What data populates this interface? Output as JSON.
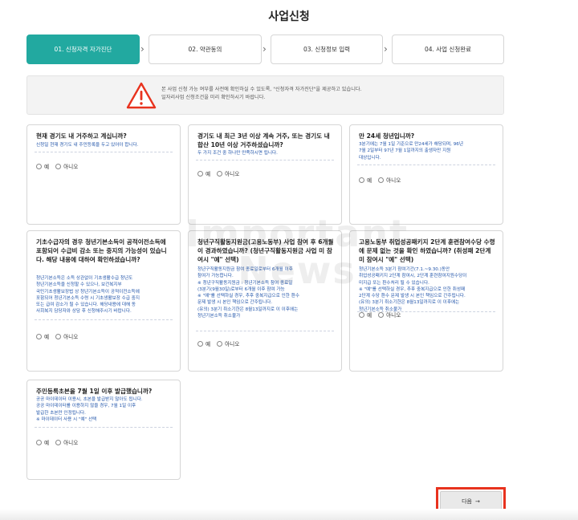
{
  "page": {
    "title": "사업신청"
  },
  "steps": [
    {
      "label": "01. 신청자격 자가진단",
      "active": true
    },
    {
      "label": "02. 약관동의",
      "active": false
    },
    {
      "label": "03. 신청정보 입력",
      "active": false
    },
    {
      "label": "04. 사업 신청완료",
      "active": false
    }
  ],
  "step_arrow": "›",
  "notice": {
    "line1": "본 사업 신청 가능 여부를 사전에 확인하실 수 있도록, \"신청자격 자가진단\"을 제공하고 있습니다.",
    "line2": "일자리사업 신청조건을 미리 확인하시기 바랍니다.",
    "icon": "warning-triangle-icon",
    "icon_color": "#e8321e"
  },
  "radio": {
    "yes": "예",
    "no": "아니오"
  },
  "questions": [
    {
      "title": "현재 경기도 내 거주하고 계십니까?",
      "desc": [
        "신청일 현재 경기도 내 주민등록을 두고 있어야 합니다."
      ]
    },
    {
      "title": "경기도 내 최근 3년 이상 계속 거주, 또는 경기도 내 합산 10년 이상 거주하셨습니까?",
      "desc": [
        "두 가지 조건 중 하나만 만족하시면 됩니다."
      ]
    },
    {
      "title": "만 24세 청년입니까?",
      "desc": [
        "3분기에는 7월 1일 기준으로 만24세가 해당되며, 96년",
        "7월 2일부터 97년 7월 1일까지의 출생자만 지원",
        "대상입니다."
      ]
    },
    {
      "title": "기초수급자의 경우 청년기본소득이 공적이전소득에 포함되어 수급비 감소 또는 중지의 가능성이 있습니다. 해당 내용에 대하여 확인하셨습니까?",
      "desc": [
        "청년기본소득은 소득 상관없이 기초생활수급 청년도",
        "청년기본소득을 신청할 수 있으나, 보건복지부",
        "국민기초생활보장법 상 청년기본소득이 공적이전소득에",
        "포함되어 청년기본소득 수령 시 기초생활보장 수급 중지",
        "또는 급여 감소가 될 수 있습니다. 해당내용에 대해 동",
        "사회복지 담당자와 상담 후 신청해주시기 바랍니다."
      ]
    },
    {
      "title": "청년구직활동지원금(고용노동부) 사업 참여 후 6개월이 경과하였습니까? (청년구직활동지원금 사업 미 참여시 \"예\" 선택)",
      "desc": [
        "청년구직활동지원금 참여 종료일로부터 6개월 이후",
        "참여가 가능합니다.",
        "※ 청년구직활동지원금 : 청년기본소득 참여 종료일",
        "(3분기(9월30일)로부터 6개월 이후 참여 가능",
        "※ \"예\"를 선택하실 경우, 추후 중복지급으로 인한 환수",
        "문제 발생 시 본인 책임으로 간주됩니다.",
        "(유의) 3분기 취소기한은 8월13일까지로 이 이후에는",
        "청년기본소득 취소불가"
      ]
    },
    {
      "title": "고용노동부 취업성공패키지 2단계 훈련참여수당 수령에 문제 없는 것을 확인 하였습니까? (취성패 2단계 미 참여시 \"예\" 선택)",
      "desc": [
        "청년기본소득 3분기 참여기간(7.1.~9.30.)동안",
        "취업성공패키지 2단계 참여시, 2단계 훈련참여지원수당이",
        "미지급 또는 환수처리 될 수 있습니다.",
        "※ \"예\"를 선택하실 경우, 추후 중복지급으로 인한 취성패",
        "2단계 수당 환수 문제 발생 시 본인 책임으로 간주됩니다.",
        "(유의) 3분기 취소기한은 8월13일까지로 이 이후에는",
        "청년기본소득 취소불가"
      ]
    },
    {
      "title": "주민등록초본을 7월 1일 이후 발급했습니까?",
      "desc": [
        "공공 마이데이터 이용시, 초본을 발급받지 않아도 됩니다.",
        "공공 마이데이터를 이용하지 않을 경우, 7월 1일 이후",
        "발급한 초본만 인정됩니다.",
        "※ 마이데이터 사용 시 \"예\" 선택"
      ]
    }
  ],
  "next_button": {
    "label": "다음",
    "arrow": "→",
    "highlight_color": "#e8321e"
  },
  "watermark": {
    "line1": "Important",
    "line2": "News"
  }
}
